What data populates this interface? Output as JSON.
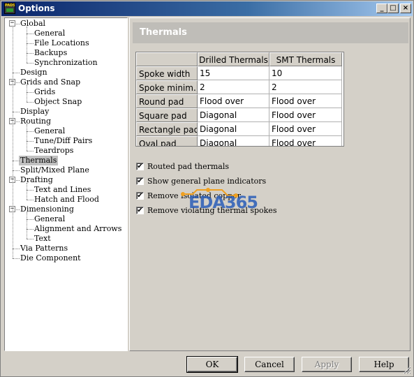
{
  "window": {
    "title": "Options",
    "icon_label": "PADS",
    "caption_buttons": {
      "minimize": "_",
      "maximize": "□",
      "close": "×"
    }
  },
  "tree": {
    "items": [
      {
        "label": "Global",
        "level": 0,
        "expander": "−"
      },
      {
        "label": "General",
        "level": 1
      },
      {
        "label": "File Locations",
        "level": 1
      },
      {
        "label": "Backups",
        "level": 1
      },
      {
        "label": "Synchronization",
        "level": 1
      },
      {
        "label": "Design",
        "level": 0
      },
      {
        "label": "Grids and Snap",
        "level": 0,
        "expander": "−"
      },
      {
        "label": "Grids",
        "level": 1
      },
      {
        "label": "Object Snap",
        "level": 1
      },
      {
        "label": "Display",
        "level": 0
      },
      {
        "label": "Routing",
        "level": 0,
        "expander": "−"
      },
      {
        "label": "General",
        "level": 1
      },
      {
        "label": "Tune/Diff Pairs",
        "level": 1
      },
      {
        "label": "Teardrops",
        "level": 1
      },
      {
        "label": "Thermals",
        "level": 0,
        "selected": true
      },
      {
        "label": "Split/Mixed Plane",
        "level": 0
      },
      {
        "label": "Drafting",
        "level": 0,
        "expander": "−"
      },
      {
        "label": "Text and Lines",
        "level": 1
      },
      {
        "label": "Hatch and Flood",
        "level": 1
      },
      {
        "label": "Dimensioning",
        "level": 0,
        "expander": "−"
      },
      {
        "label": "General",
        "level": 1
      },
      {
        "label": "Alignment and Arrows",
        "level": 1
      },
      {
        "label": "Text",
        "level": 1
      },
      {
        "label": "Via Patterns",
        "level": 0
      },
      {
        "label": "Die Component",
        "level": 0
      }
    ]
  },
  "content": {
    "header": "Thermals",
    "table": {
      "columns": [
        "",
        "Drilled Thermals",
        "SMT Thermals"
      ],
      "rows": [
        {
          "label": "Spoke width",
          "drilled": "15",
          "smt": "10"
        },
        {
          "label": "Spoke minim...",
          "drilled": "2",
          "smt": "2"
        },
        {
          "label": "Round pad",
          "drilled": "Flood over",
          "smt": "Flood over"
        },
        {
          "label": "Square pad",
          "drilled": "Diagonal",
          "smt": "Flood over"
        },
        {
          "label": "Rectangle pad",
          "drilled": "Diagonal",
          "smt": "Flood over"
        },
        {
          "label": "Oval pad",
          "drilled": "Diagonal",
          "smt": "Flood over"
        }
      ]
    },
    "checkboxes": [
      {
        "label": "Routed pad thermals",
        "checked": true
      },
      {
        "label": "Show general plane indicators",
        "checked": true
      },
      {
        "label": "Remove isolated copper",
        "checked": true
      },
      {
        "label": "Remove violating thermal spokes",
        "checked": true
      }
    ],
    "watermark": "EDA365"
  },
  "buttons": {
    "ok": "OK",
    "cancel": "Cancel",
    "apply": "Apply",
    "help": "Help"
  },
  "checkmark_glyph": "✔"
}
